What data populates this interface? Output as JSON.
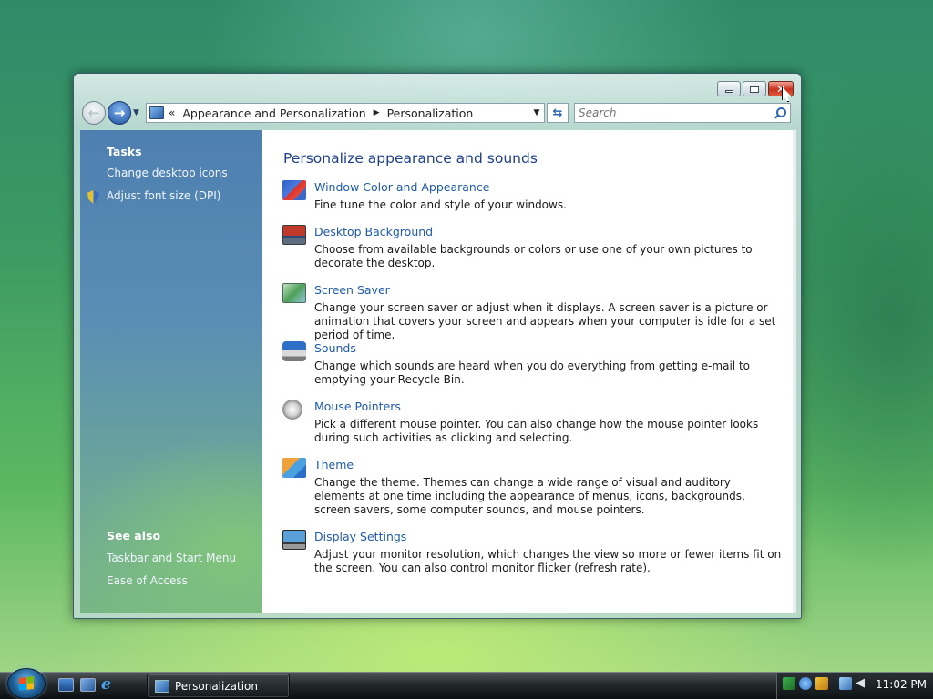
{
  "window": {
    "title": "Personalization",
    "caption": {
      "minimize": "minimize",
      "maximize": "maximize",
      "close": "close"
    }
  },
  "navbar": {
    "crumb_sep": "«",
    "breadcrumbs": [
      "Appearance and Personalization",
      "Personalization"
    ],
    "search_placeholder": "Search"
  },
  "left_pane": {
    "tasks_title": "Tasks",
    "tasks": [
      "Change desktop icons",
      "Adjust font size (DPI)"
    ],
    "see_also_title": "See also",
    "see_also": [
      "Taskbar and Start Menu",
      "Ease of Access"
    ]
  },
  "main": {
    "title": "Personalize appearance and sounds",
    "items": [
      {
        "icon": "window-color-icon",
        "label": "Window Color and Appearance",
        "desc": "Fine tune the color and style of your windows."
      },
      {
        "icon": "desktop-background-icon",
        "label": "Desktop Background",
        "desc": "Choose from available backgrounds or colors or use one of your own pictures to decorate the desktop."
      },
      {
        "icon": "screen-saver-icon",
        "label": "Screen Saver",
        "desc": "Change your screen saver or adjust when it displays. A screen saver is a picture or animation that covers your screen and appears when your computer is idle for a set period of time."
      },
      {
        "icon": "sounds-icon",
        "label": "Sounds",
        "desc": "Change which sounds are heard when you do everything from getting e-mail to emptying your Recycle Bin."
      },
      {
        "icon": "mouse-pointers-icon",
        "label": "Mouse Pointers",
        "desc": "Pick a different mouse pointer. You can also change how the mouse pointer looks during such activities as clicking and selecting."
      },
      {
        "icon": "theme-icon",
        "label": "Theme",
        "desc": "Change the theme. Themes can change a wide range of visual and auditory elements at one time including the appearance of menus, icons, backgrounds, screen savers, some computer sounds, and mouse pointers."
      },
      {
        "icon": "display-settings-icon",
        "label": "Display Settings",
        "desc": "Adjust your monitor resolution, which changes the view so more or fewer items fit on the screen. You can also control monitor flicker (refresh rate)."
      }
    ]
  },
  "taskbar": {
    "task_label": "Personalization",
    "clock": "11:02 PM"
  },
  "colors": {
    "link": "#1f5ba8",
    "heading": "#1e3f8a",
    "pane_blue": "#4e7fb1"
  }
}
